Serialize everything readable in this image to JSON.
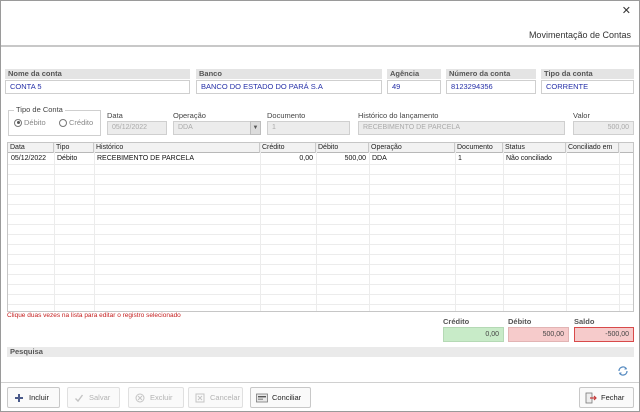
{
  "window": {
    "title": "Movimentação de Contas",
    "close_glyph": "✕"
  },
  "account": {
    "nome_label": "Nome da conta",
    "nome_value": "CONTA 5",
    "banco_label": "Banco",
    "banco_value": "BANCO DO ESTADO DO PARÁ S.A",
    "agencia_label": "Agência",
    "agencia_value": "49",
    "numero_label": "Número da conta",
    "numero_value": "8123294356",
    "tipo_label": "Tipo da conta",
    "tipo_value": "CORRENTE"
  },
  "form": {
    "tipo_conta_legend": "Tipo de Conta",
    "debito_label": "Débito",
    "credito_label": "Crédito",
    "selected": "Débito",
    "data_label": "Data",
    "data_value": "05/12/2022",
    "operacao_label": "Operação",
    "operacao_value": "DDA",
    "documento_label": "Documento",
    "documento_value": "1",
    "historico_label": "Histórico do lançamento",
    "historico_value": "RECEBIMENTO DE PARCELA",
    "valor_label": "Valor",
    "valor_value": "500,00"
  },
  "grid": {
    "columns": [
      "Data",
      "Tipo",
      "Histórico",
      "Crédito",
      "Débito",
      "Operação",
      "Documento",
      "Status",
      "Conciliado em"
    ],
    "rows": [
      {
        "data": "05/12/2022",
        "tipo": "Débito",
        "historico": "RECEBIMENTO DE PARCELA",
        "credito": "0,00",
        "debito": "500,00",
        "operacao": "DDA",
        "documento": "1",
        "status": "Não conciliado",
        "conciliado_em": ""
      }
    ]
  },
  "hint": "Clique duas vezes na lista para editar o registro selecionado",
  "totals": {
    "credito_label": "Crédito",
    "credito_value": "0,00",
    "debito_label": "Débito",
    "debito_value": "500,00",
    "saldo_label": "Saldo",
    "saldo_value": "-500,00"
  },
  "search": {
    "label": "Pesquisa"
  },
  "toolbar": {
    "incluir": "Incluir",
    "salvar": "Salvar",
    "excluir": "Excluir",
    "cancelar": "Cancelar",
    "conciliar": "Conciliar",
    "fechar": "Fechar"
  },
  "colors": {
    "link_blue": "#2630a8",
    "hint_red": "#c41e1e",
    "credit_bg": "#c8ebc8",
    "debit_bg": "#f6cbcb",
    "saldo_border": "#d84a4a"
  }
}
